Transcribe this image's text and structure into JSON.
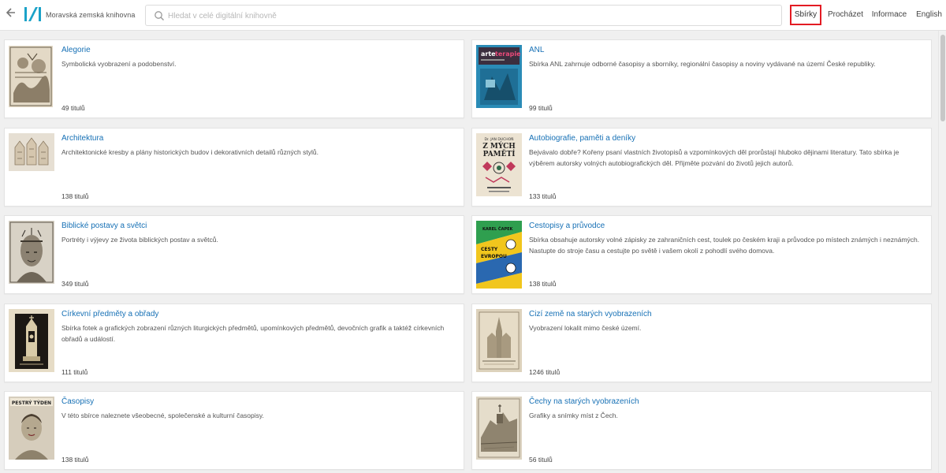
{
  "header": {
    "logo_text": "Moravská zemská knihovna",
    "search_placeholder": "Hledat v celé digitální knihovně",
    "nav": [
      {
        "label": "Sbírky",
        "active": true
      },
      {
        "label": "Procházet"
      },
      {
        "label": "Informace"
      },
      {
        "label": "English"
      }
    ],
    "accent_color": "#1670b5",
    "active_border_color": "#e31b23"
  },
  "collections": [
    {
      "title": "Alegorie",
      "description": "Symbolická vyobrazení a podobenství.",
      "count": "49 titulů"
    },
    {
      "title": "ANL",
      "description": "Sbírka ANL zahrnuje odborné časopisy a sborníky, regionální časopisy a noviny vydávané na území České republiky.",
      "count": "99 titulů"
    },
    {
      "title": "Architektura",
      "description": "Architektonické kresby a plány historických budov i dekorativních detailů různých stylů.",
      "count": "138 titulů"
    },
    {
      "title": "Autobiografie, paměti a deníky",
      "description": "Bejvávalo dobře? Kořeny psaní vlastních životopisů a vzpomínkových děl prorůstají hluboko dějinami literatury. Tato sbírka je výběrem autorsky volných autobiografických děl. Přijměte pozvání do životů jejich autorů.",
      "count": "133 titulů"
    },
    {
      "title": "Biblické postavy a světci",
      "description": "Portréty i výjevy ze života biblických postav a světců.",
      "count": "349 titulů"
    },
    {
      "title": "Cestopisy a průvodce",
      "description": "Sbírka obsahuje autorsky volné zápisky ze zahraničních cest, toulek po českém kraji a průvodce po místech známých i neznámých. Nastupte do stroje času a cestujte po světě i vašem okolí z pohodlí svého domova.",
      "count": "138 titulů"
    },
    {
      "title": "Církevní předměty a obřady",
      "description": "Sbírka fotek a grafických zobrazení různých liturgických předmětů, upomínkových předmětů, devočních grafik a taktéž církevních obřadů a událostí.",
      "count": "111 titulů"
    },
    {
      "title": "Cizí země na starých vyobrazeních",
      "description": "Vyobrazení lokalit mimo české území.",
      "count": "1246 titulů"
    },
    {
      "title": "Časopisy",
      "description": "V této sbírce naleznete všeobecné, společenské a kulturní časopisy.",
      "count": "138 titulů"
    },
    {
      "title": "Čechy na starých vyobrazeních",
      "description": "Grafiky a snímky míst z Čech.",
      "count": "56 titulů"
    }
  ],
  "thumbnails": {
    "anl": {
      "line1": "arte",
      "line2": "terapie"
    },
    "autobiografie": {
      "author": "Dr. JAN DUCHOŇ",
      "title1": "Z MÝCH",
      "title2": "PAMĚTÍ"
    },
    "cestopisy": {
      "author": "KAREL ČAPEK",
      "title1": "CESTY",
      "title2": "EVROPOU"
    },
    "casopisy": {
      "header": "PESTRÝ TÝDEN"
    }
  }
}
